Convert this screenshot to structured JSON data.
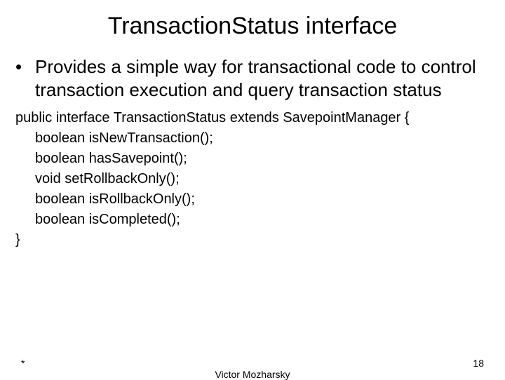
{
  "title": "TransactionStatus interface",
  "bullet": {
    "marker": "•",
    "text": "Provides a simple way for transactional code to control transaction execution and query transaction status"
  },
  "code": {
    "line0": "public interface TransactionStatus extends SavepointManager {",
    "line1": "boolean isNewTransaction();",
    "line2": "boolean hasSavepoint();",
    "line3": "void setRollbackOnly();",
    "line4": "boolean isRollbackOnly();",
    "line5": "boolean isCompleted();",
    "line6": "}"
  },
  "footer": {
    "left": "*",
    "center": "Victor Mozharsky",
    "right": "18"
  }
}
